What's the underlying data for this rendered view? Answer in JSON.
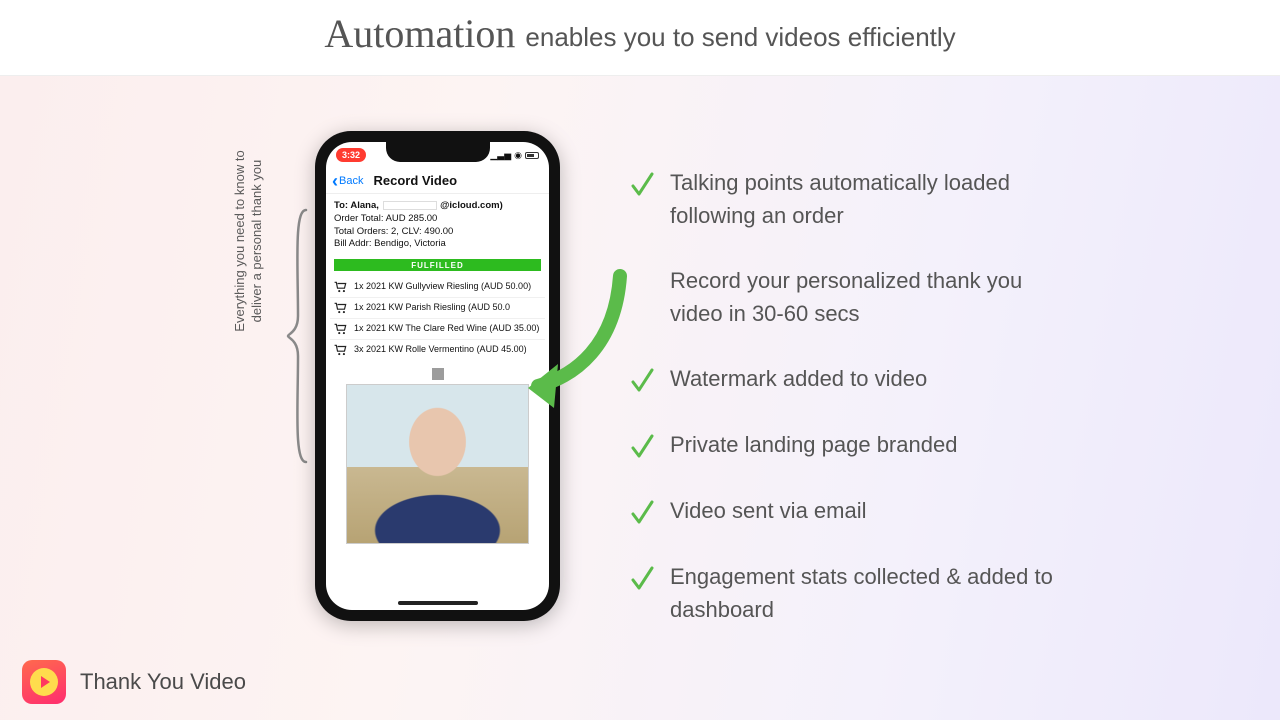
{
  "header": {
    "automation_word": "Automation",
    "rest": "enables you to send videos efficiently"
  },
  "vertical_label_line1": "Everything you need to know to",
  "vertical_label_line2": "deliver a personal thank you",
  "phone": {
    "time": "3:32",
    "back_label": "Back",
    "title": "Record Video",
    "to_prefix": "To: ",
    "to_name": "Alana,",
    "to_email_suffix": "@icloud.com)",
    "order_total": "Order Total: AUD 285.00",
    "total_orders": "Total Orders: 2, CLV: 490.00",
    "bill_addr": "Bill Addr: Bendigo, Victoria",
    "status": "FULFILLED",
    "items": [
      "1x 2021 KW Gullyview Riesling (AUD 50.00)",
      "1x 2021 KW Parish Riesling (AUD 50.0",
      "1x 2021 KW The Clare Red Wine (AUD 35.00)",
      "3x 2021 KW Rolle Vermentino (AUD 45.00)"
    ]
  },
  "features": [
    "Talking points automatically loaded following an order",
    "Record your personalized thank you video in 30-60 secs",
    "Watermark added to video",
    "Private landing page branded",
    "Video sent via email",
    "Engagement stats collected & added to dashboard"
  ],
  "brand": {
    "name": "Thank You Video"
  },
  "colors": {
    "check": "#5bbb4a",
    "arrow": "#5bbb4a",
    "accent": "#ff3b30"
  }
}
